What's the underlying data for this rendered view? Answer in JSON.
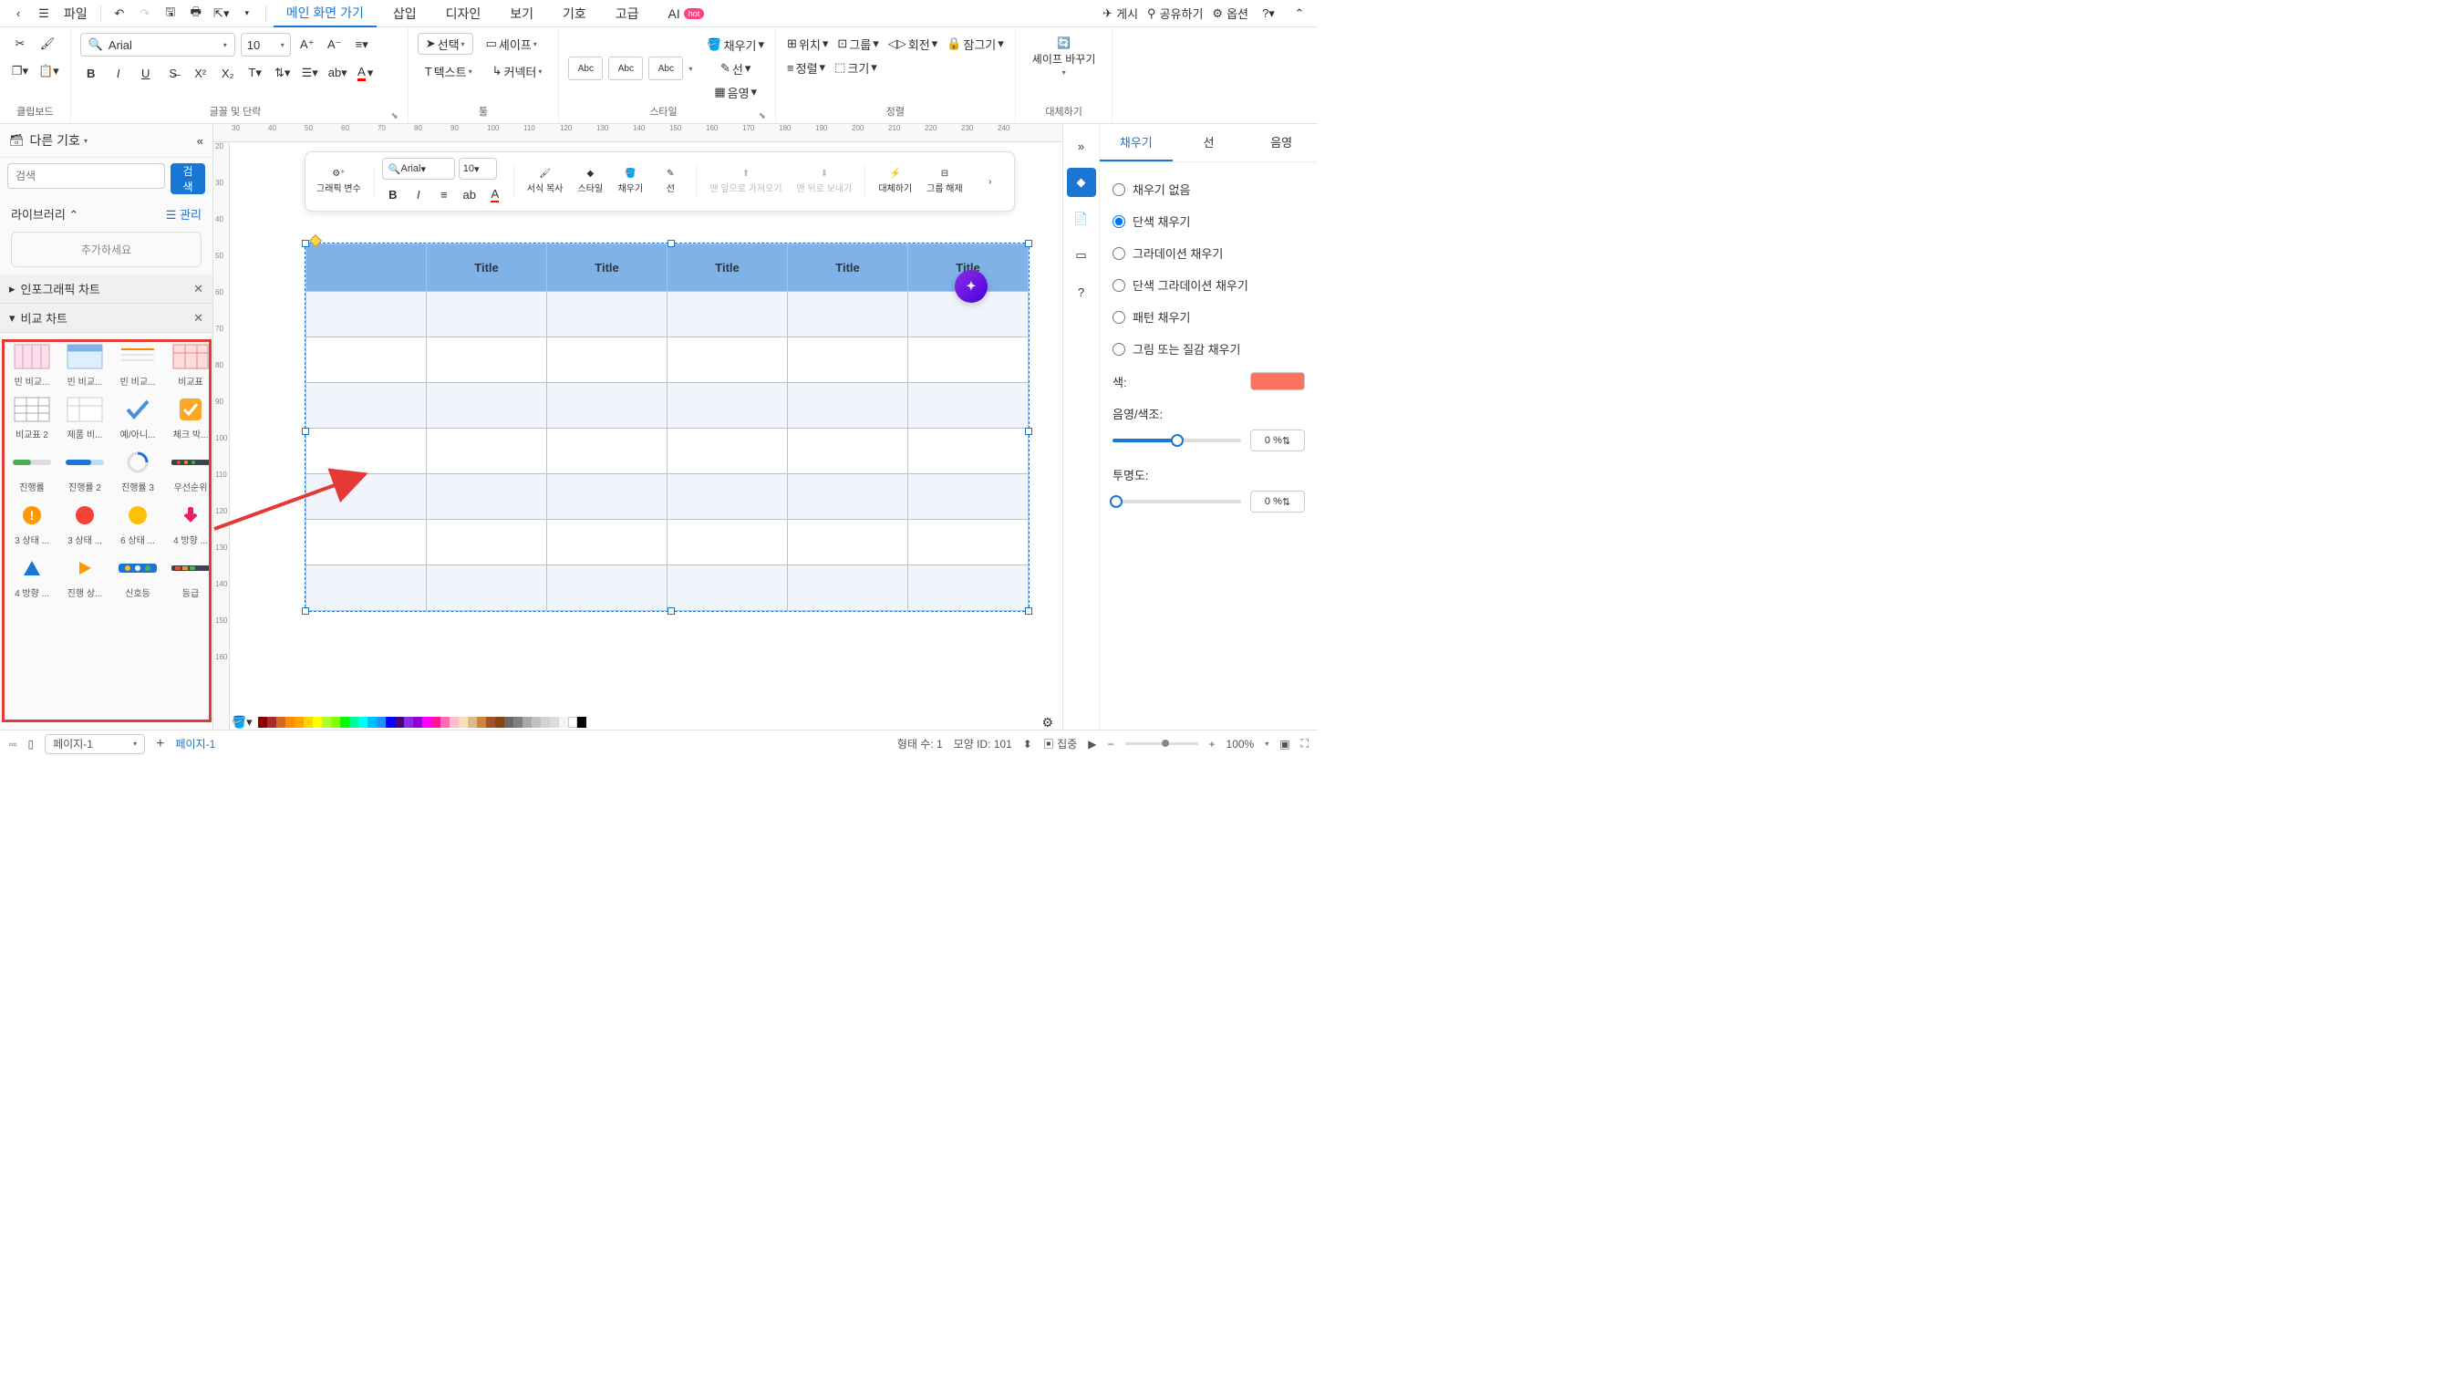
{
  "menubar": {
    "file": "파일",
    "tabs": [
      "메인 화면 가기",
      "삽입",
      "디자인",
      "보기",
      "기호",
      "고급",
      "AI"
    ],
    "active_tab": 0,
    "hot": "hot",
    "publish": "게시",
    "share": "공유하기",
    "options": "옵션"
  },
  "ribbon": {
    "clipboard": "클립보드",
    "font_paragraph": "글꼴 및 단락",
    "tool": "툴",
    "style": "스타일",
    "arrange": "정렬",
    "replace": "대체하기",
    "font_name": "Arial",
    "font_size": "10",
    "select": "선택",
    "shape": "셰이프",
    "style_abc": "Abc",
    "text": "텍스트",
    "connector": "커넥터",
    "fill": "채우기",
    "line": "선",
    "shadow": "음영",
    "position": "위치",
    "align": "정렬",
    "group": "그룹",
    "size": "크기",
    "rotate": "회전",
    "lock": "잠그기",
    "replace_shape": "셰이프 바꾸기"
  },
  "left": {
    "title": "다른 기호",
    "search_placeholder": "검색",
    "search_btn": "검색",
    "library": "라이브러리",
    "manage": "관리",
    "add_hint": "추가하세요",
    "cat1": "인포그래픽 차트",
    "cat2": "비교 차트",
    "shapes": [
      "빈 비교...",
      "빈 비교...",
      "빈 비교...",
      "비교표",
      "비교표 2",
      "제품 비...",
      "예/아니...",
      "체크 박...",
      "진행률",
      "진행률 2",
      "진행률 3",
      "우선순위",
      "3 상태 ...",
      "3 상태 ...",
      "6 상태 ...",
      "4 방향 ...",
      "4 방향 ...",
      "진행 상...",
      "신호등",
      "등급"
    ]
  },
  "float": {
    "graphic_var": "그래픽 변수",
    "font": "Arial",
    "size": "10",
    "format_copy": "서식 복사",
    "style": "스타일",
    "fill": "채우기",
    "line": "선",
    "bring_front": "맨 앞으로 가져오기",
    "send_back": "맨 뒤로 보내기",
    "replace": "대체하기",
    "ungroup": "그룹 해제"
  },
  "table": {
    "headers": [
      "Title",
      "Title",
      "Title",
      "Title",
      "Title"
    ]
  },
  "right": {
    "tab_fill": "채우기",
    "tab_line": "선",
    "tab_shadow": "음영",
    "no_fill": "채우기 없음",
    "solid_fill": "단색 채우기",
    "gradient_fill": "그라데이션 채우기",
    "solid_gradient": "단색 그라데이션 채우기",
    "pattern_fill": "패턴 채우기",
    "picture_fill": "그림 또는 질감 채우기",
    "color_label": "색:",
    "shade_label": "음영/색조:",
    "transparency_label": "투명도:",
    "shade_value": "0 %",
    "transparency_value": "0 %"
  },
  "ruler_h": [
    "30",
    "40",
    "50",
    "60",
    "70",
    "80",
    "90",
    "100",
    "110",
    "120",
    "130",
    "140",
    "150",
    "160",
    "170",
    "180",
    "190",
    "200",
    "210",
    "220",
    "230",
    "240"
  ],
  "ruler_v": [
    "20",
    "30",
    "40",
    "50",
    "60",
    "70",
    "80",
    "90",
    "100",
    "110",
    "120",
    "130",
    "140",
    "150",
    "160"
  ],
  "status": {
    "page_sel": "페이지-1",
    "page_tab": "페이지-1",
    "shape_count": "형태 수: 1",
    "shape_id": "모양 ID: 101",
    "focus": "집중",
    "zoom": "100%"
  }
}
